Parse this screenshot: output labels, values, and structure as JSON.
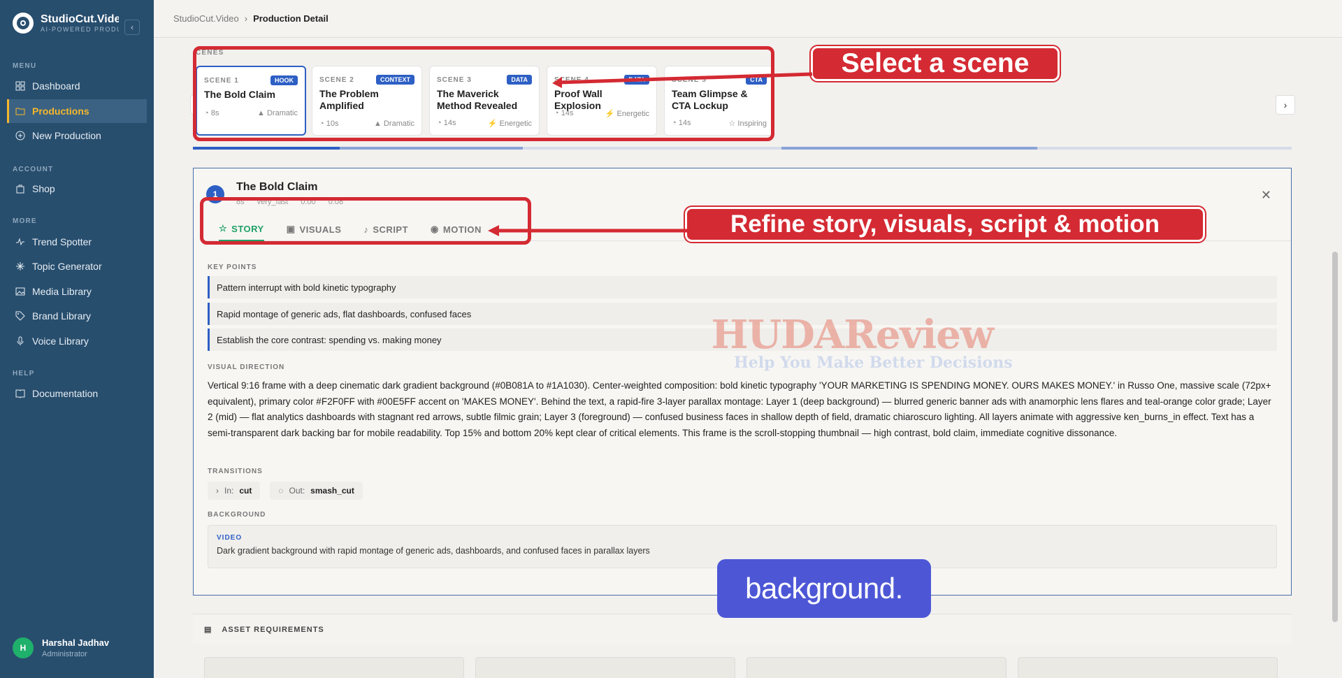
{
  "app": {
    "name": "StudioCut.Video",
    "tagline": "AI-POWERED PRODUCTION"
  },
  "sidebar": {
    "sections": [
      {
        "label": "MENU"
      },
      {
        "label": "ACCOUNT"
      },
      {
        "label": "MORE"
      },
      {
        "label": "HELP"
      }
    ],
    "items": [
      {
        "label": "Dashboard"
      },
      {
        "label": "Productions"
      },
      {
        "label": "New Production"
      },
      {
        "label": "Shop"
      },
      {
        "label": "Trend Spotter"
      },
      {
        "label": "Topic Generator"
      },
      {
        "label": "Media Library"
      },
      {
        "label": "Brand Library"
      },
      {
        "label": "Voice Library"
      },
      {
        "label": "Documentation"
      }
    ]
  },
  "user": {
    "initial": "H",
    "name": "Harshal Jadhav",
    "role": "Administrator"
  },
  "breadcrumb": {
    "root": "StudioCut.Video",
    "current": "Production Detail"
  },
  "scenes_label": "CENES",
  "scenes": [
    {
      "num": "SCENE 1",
      "tag": "HOOK",
      "title": "The Bold Claim",
      "duration": "8s",
      "mood": "Dramatic"
    },
    {
      "num": "SCENE 2",
      "tag": "CONTEXT",
      "title": "The Problem Amplified",
      "duration": "10s",
      "mood": "Dramatic"
    },
    {
      "num": "SCENE 3",
      "tag": "DATA",
      "title": "The Maverick Method Revealed",
      "duration": "14s",
      "mood": "Energetic"
    },
    {
      "num": "SCENE 4",
      "tag": "DATA",
      "title": "Proof Wall Explosion",
      "duration": "14s",
      "mood": "Energetic"
    },
    {
      "num": "SCENE 5",
      "tag": "CTA",
      "title": "Team Glimpse & CTA Lockup",
      "duration": "14s",
      "mood": "Inspiring"
    }
  ],
  "panel": {
    "number": "1",
    "title": "The Bold Claim",
    "meta_duration": "8s",
    "meta_speed": "very_fast",
    "meta_start": "0:00",
    "meta_end": "0:08",
    "tabs": [
      {
        "label": "STORY"
      },
      {
        "label": "VISUALS"
      },
      {
        "label": "SCRIPT"
      },
      {
        "label": "MOTION"
      }
    ],
    "key_points_label": "KEY POINTS",
    "key_points": [
      "Pattern interrupt with bold kinetic typography",
      "Rapid montage of generic ads, flat dashboards, confused faces",
      "Establish the core contrast: spending vs. making money"
    ],
    "visual_direction_label": "VISUAL DIRECTION",
    "visual_direction": "Vertical 9:16 frame with a deep cinematic dark gradient background (#0B081A to #1A1030). Center-weighted composition: bold kinetic typography 'YOUR MARKETING IS SPENDING MONEY. OURS MAKES MONEY.' in Russo One, massive scale (72px+ equivalent), primary color #F2F0FF with #00E5FF accent on 'MAKES MONEY'. Behind the text, a rapid-fire 3-layer parallax montage: Layer 1 (deep background) — blurred generic banner ads with anamorphic lens flares and teal-orange color grade; Layer 2 (mid) — flat analytics dashboards with stagnant red arrows, subtle filmic grain; Layer 3 (foreground) — confused business faces in shallow depth of field, dramatic chiaroscuro lighting. All layers animate with aggressive ken_burns_in effect. Text has a semi-transparent dark backing bar for mobile readability. Top 15% and bottom 20% kept clear of critical elements. This frame is the scroll-stopping thumbnail — high contrast, bold claim, immediate cognitive dissonance.",
    "transitions_label": "TRANSITIONS",
    "in_label": "In:",
    "in_value": "cut",
    "out_label": "Out:",
    "out_value": "smash_cut",
    "background_label": "BACKGROUND",
    "background_type": "VIDEO",
    "background_desc": "Dark gradient background with rapid montage of generic ads, dashboards, and confused faces in parallax layers"
  },
  "assets": {
    "label": "ASSET REQUIREMENTS"
  },
  "annotations": {
    "select": "Select a scene",
    "refine": "Refine story, visuals, script & motion"
  },
  "caption": "background.",
  "watermark": {
    "title": "HUDAReview",
    "sub": "Help You Make Better Decisions"
  },
  "colors": {
    "sidebar": "#284e6e",
    "accent": "#f4b72b",
    "primary": "#2d5fc4",
    "story_green": "#1fa065",
    "annotation_red": "#d42a33",
    "caption_bg": "#4d57d6"
  }
}
